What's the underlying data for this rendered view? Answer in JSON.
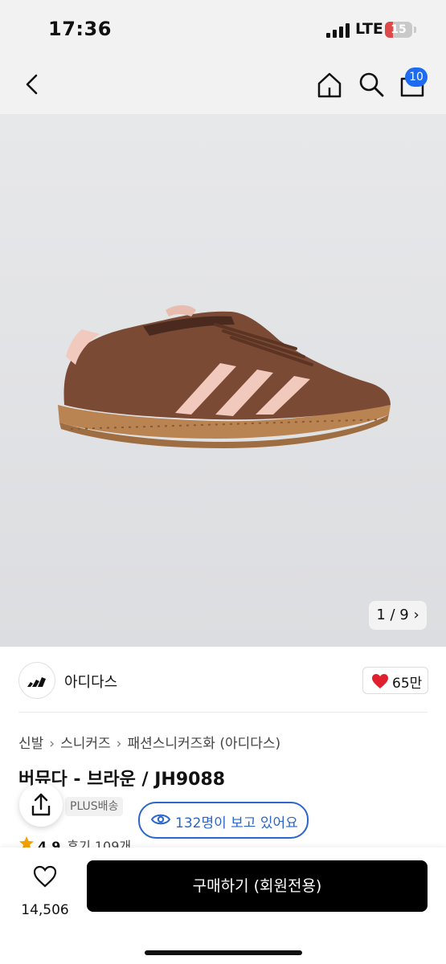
{
  "status_bar": {
    "time": "17:36",
    "network": "LTE",
    "battery": "15",
    "battery_color": "#e0494a"
  },
  "nav": {
    "cart_badge": "10",
    "icons": [
      "back-icon",
      "home-icon",
      "search-icon",
      "cart-icon"
    ]
  },
  "gallery": {
    "pager": "1 / 9 ›",
    "current": 1,
    "total": 9
  },
  "brand": {
    "name": "아디다스",
    "likes": "65만"
  },
  "breadcrumb": [
    "신발",
    "스니커즈",
    "패션스니커즈화 (아디다스)"
  ],
  "product": {
    "title": "버뮤다 - 브라운 / JH9088",
    "delivery_badge": "PLUS배송",
    "rating": "4.9",
    "reviews": "후기 109개"
  },
  "viewers": {
    "label": "132명이 보고 있어요"
  },
  "bottom": {
    "wish_count": "14,506",
    "buy_label": "구매하기 (회원전용)"
  },
  "colors": {
    "accent_blue": "#2b66c8",
    "badge_blue": "#1d6bf1",
    "heart_red": "#e0202f",
    "star": "#f2a100",
    "shoe_brown": "#7a4a35",
    "stripe_pink": "#f1c9bd",
    "gum_sole": "#b98352"
  }
}
